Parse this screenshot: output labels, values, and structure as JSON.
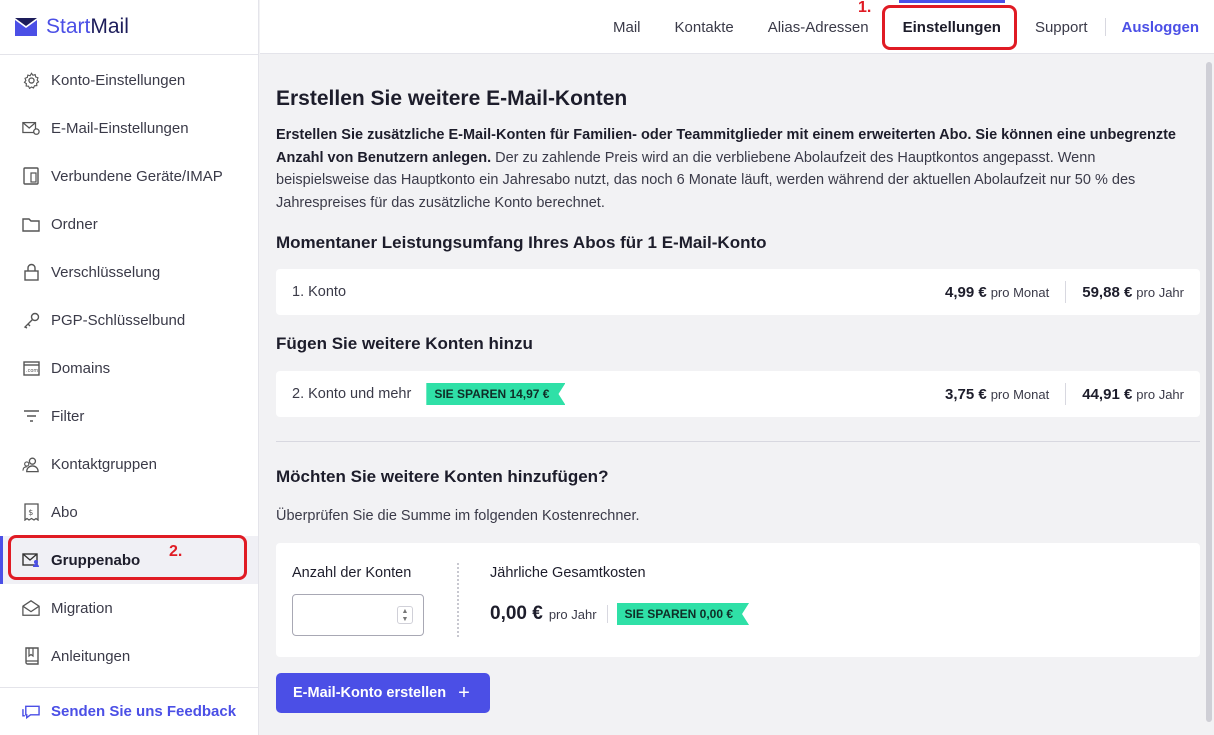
{
  "brand": {
    "part1": "Start",
    "part2": "Mail"
  },
  "sidebar": {
    "items": [
      {
        "label": "Konto-Einstellungen",
        "icon": "gear-icon"
      },
      {
        "label": "E-Mail-Einstellungen",
        "icon": "mail-settings-icon"
      },
      {
        "label": "Verbundene Geräte/IMAP",
        "icon": "devices-icon"
      },
      {
        "label": "Ordner",
        "icon": "folder-icon"
      },
      {
        "label": "Verschlüsselung",
        "icon": "lock-icon"
      },
      {
        "label": "PGP-Schlüsselbund",
        "icon": "key-icon"
      },
      {
        "label": "Domains",
        "icon": "domain-icon"
      },
      {
        "label": "Filter",
        "icon": "filter-icon"
      },
      {
        "label": "Kontaktgruppen",
        "icon": "contact-groups-icon"
      },
      {
        "label": "Abo",
        "icon": "subscription-icon"
      },
      {
        "label": "Gruppenabo",
        "icon": "group-mail-icon",
        "active": true
      },
      {
        "label": "Migration",
        "icon": "migration-icon"
      },
      {
        "label": "Anleitungen",
        "icon": "book-icon"
      }
    ],
    "feedback": "Senden Sie uns Feedback"
  },
  "topnav": {
    "mail": "Mail",
    "kontakte": "Kontakte",
    "alias": "Alias-Adressen",
    "einstellungen": "Einstellungen",
    "support": "Support",
    "logout": "Ausloggen"
  },
  "annotations": {
    "one": "1.",
    "two": "2."
  },
  "main": {
    "title": "Erstellen Sie weitere E-Mail-Konten",
    "intro_bold": "Erstellen Sie zusätzliche E-Mail-Konten für Familien- oder Teammitglieder mit einem erweiterten Abo. Sie können eine unbegrenzte Anzahl von Benutzern anlegen.",
    "intro_rest": " Der zu zahlende Preis wird an die verbliebene Abolaufzeit des Hauptkontos angepasst. Wenn beispielsweise das Hauptkonto ein Jahresabo nutzt, das noch 6 Monate läuft, werden während der aktuellen Abolaufzeit nur 50 % des Jahrespreises für das zusätzliche Konto berechnet.",
    "current_heading": "Momentaner Leistungsumfang Ihres Abos für 1 E-Mail-Konto",
    "current_row": {
      "label": "1. Konto",
      "monthly": "4,99 €",
      "monthly_unit": "pro Monat",
      "yearly": "59,88 €",
      "yearly_unit": "pro Jahr"
    },
    "add_heading": "Fügen Sie weitere Konten hinzu",
    "add_row": {
      "label": "2. Konto und mehr",
      "badge": "SIE SPAREN 14,97 €",
      "monthly": "3,75 €",
      "monthly_unit": "pro Monat",
      "yearly": "44,91 €",
      "yearly_unit": "pro Jahr"
    },
    "question_heading": "Möchten Sie weitere Konten hinzufügen?",
    "question_sub": "Überprüfen Sie die Summe im folgenden Kostenrechner.",
    "calculator": {
      "count_label": "Anzahl der Konten",
      "count_value": "",
      "total_label": "Jährliche Gesamtkosten",
      "total_value": "0,00 €",
      "total_unit": "pro Jahr",
      "badge": "SIE SPAREN 0,00 €"
    },
    "create_button": "E-Mail-Konto erstellen",
    "create_button_icon": "plus-icon"
  },
  "colors": {
    "accent": "#4b4fe6",
    "badge": "#2fe0a7",
    "annotation": "#e01b24"
  }
}
